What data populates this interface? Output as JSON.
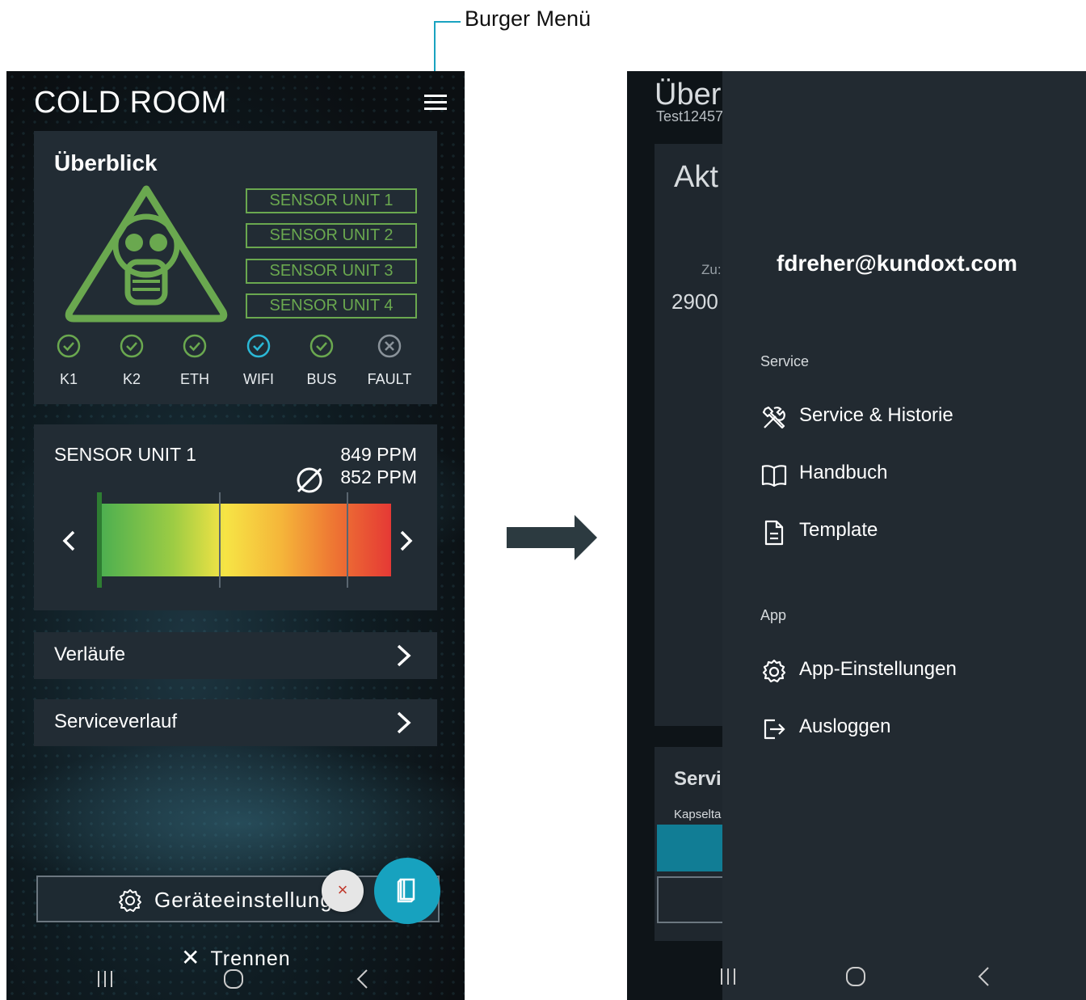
{
  "annotation": {
    "label": "Burger Menü"
  },
  "left_screen": {
    "title": "COLD ROOM",
    "overview": {
      "heading": "Überblick",
      "sensor_units": [
        "SENSOR UNIT 1",
        "SENSOR UNIT 2",
        "SENSOR UNIT 3",
        "SENSOR UNIT 4"
      ],
      "statuses": [
        {
          "label": "K1",
          "state": "ok",
          "color": "#6aa84f"
        },
        {
          "label": "K2",
          "state": "ok",
          "color": "#6aa84f"
        },
        {
          "label": "ETH",
          "state": "ok",
          "color": "#6aa84f"
        },
        {
          "label": "WIFI",
          "state": "active",
          "color": "#2bb8d6"
        },
        {
          "label": "BUS",
          "state": "ok",
          "color": "#6aa84f"
        },
        {
          "label": "FAULT",
          "state": "inactive",
          "color": "#8a939a"
        }
      ]
    },
    "sensor_card": {
      "name": "SENSOR UNIT 1",
      "current": "849 PPM",
      "average": "852 PPM"
    },
    "menu_rows": [
      "Verläufe",
      "Serviceverlauf"
    ],
    "geraete_button": "Geräteeinstellungen",
    "close_fab": "×",
    "trennen": "Trennen"
  },
  "right_screen": {
    "background": {
      "title": "Über",
      "subtitle": "Test12457",
      "card_title": "Akt",
      "label": "Zu:",
      "value": "2900",
      "service_title": "Servi",
      "kapsel": "Kapselta"
    },
    "drawer": {
      "email": "fdreher@kundoxt.com",
      "sections": [
        {
          "title": "Service",
          "items": [
            {
              "label": "Service & Historie",
              "icon": "tools-icon"
            },
            {
              "label": "Handbuch",
              "icon": "book-icon"
            },
            {
              "label": "Template",
              "icon": "document-icon"
            }
          ]
        },
        {
          "title": "App",
          "items": [
            {
              "label": "App-Einstellungen",
              "icon": "gear-icon"
            },
            {
              "label": "Ausloggen",
              "icon": "logout-icon"
            }
          ]
        }
      ]
    }
  },
  "colors": {
    "accent_green": "#6aa84f",
    "accent_teal": "#17a2bf",
    "card_bg": "#222c34"
  }
}
